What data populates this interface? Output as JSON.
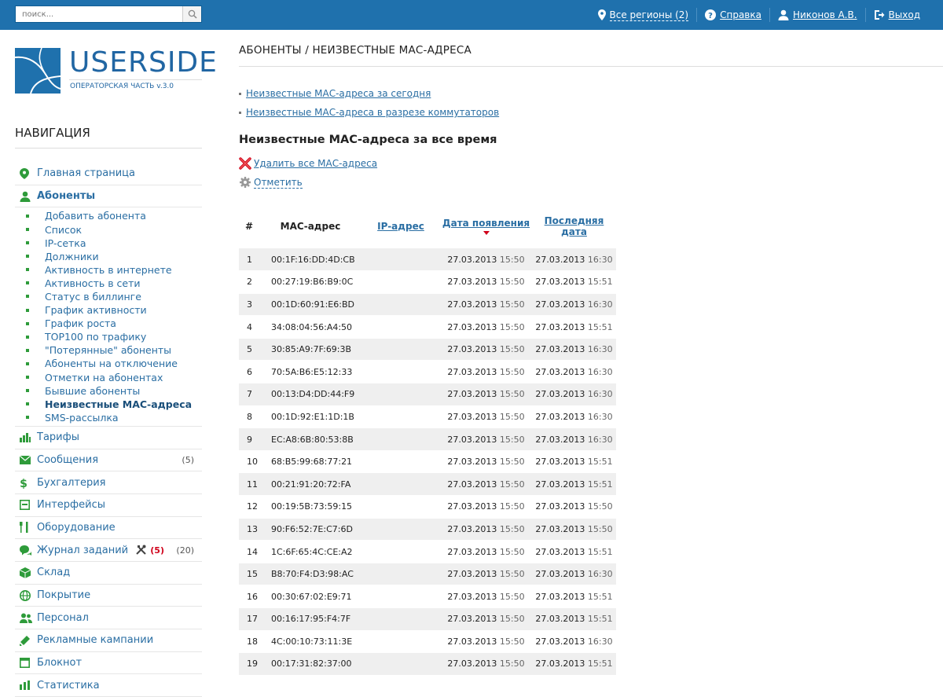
{
  "topbar": {
    "search_placeholder": "поиск...",
    "regions": "Все регионы (2)",
    "help": "Справка",
    "user": "Никонов А.В.",
    "logout": "Выход"
  },
  "logo": {
    "name": "USERSIDE",
    "subtitle": "ОПЕРАТОРСКАЯ ЧАСТЬ v.3.0"
  },
  "nav": {
    "title": "НАВИГАЦИЯ",
    "main_page": "Главная страница",
    "subscribers": "Абоненты",
    "sub_items": [
      "Добавить абонента",
      "Список",
      "IP-сетка",
      "Должники",
      "Активность в интернете",
      "Активность в сети",
      "Статус в биллинге",
      "График активности",
      "График роста",
      "ТОР100 по трафику",
      "\"Потерянные\" абоненты",
      "Абоненты на отключение",
      "Отметки на абонентах",
      "Бывшие абоненты",
      "Неизвестные МАС-адреса",
      "SMS-рассылка"
    ],
    "tariffs": "Тарифы",
    "messages": "Сообщения",
    "messages_count": "(5)",
    "accounting": "Бухгалтерия",
    "interfaces": "Интерфейсы",
    "equipment": "Оборудование",
    "tasks": "Журнал заданий",
    "tasks_red": "(5)",
    "tasks_count": "(20)",
    "warehouse": "Склад",
    "coverage": "Покрытие",
    "staff": "Персонал",
    "ads": "Рекламные кампании",
    "notepad": "Блокнот",
    "stats": "Статистика"
  },
  "main": {
    "page_title": "АБОНЕНТЫ / НЕИЗВЕСТНЫЕ МАС-АДРЕСА",
    "link_today": "Неизвестные МАС-адреса за сегодня",
    "link_switches": "Неизвестные МАС-адреса в разрезе коммутаторов",
    "heading": "Неизвестные МАС-адреса за все время",
    "delete_all": "Удалить все МАС-адреса",
    "mark": "Отметить"
  },
  "table": {
    "headers": {
      "num": "#",
      "mac": "МАС-адрес",
      "ip": "IP-адрес",
      "first": "Дата появления",
      "last": "Последняя дата"
    },
    "rows": [
      {
        "n": "1",
        "mac": "00:1F:16:DD:4D:CB",
        "d1": "27.03.2013",
        "t1": "15:50",
        "d2": "27.03.2013",
        "t2": "16:30"
      },
      {
        "n": "2",
        "mac": "00:27:19:B6:B9:0C",
        "d1": "27.03.2013",
        "t1": "15:50",
        "d2": "27.03.2013",
        "t2": "15:51"
      },
      {
        "n": "3",
        "mac": "00:1D:60:91:E6:BD",
        "d1": "27.03.2013",
        "t1": "15:50",
        "d2": "27.03.2013",
        "t2": "16:30"
      },
      {
        "n": "4",
        "mac": "34:08:04:56:A4:50",
        "d1": "27.03.2013",
        "t1": "15:50",
        "d2": "27.03.2013",
        "t2": "15:51"
      },
      {
        "n": "5",
        "mac": "30:85:A9:7F:69:3B",
        "d1": "27.03.2013",
        "t1": "15:50",
        "d2": "27.03.2013",
        "t2": "16:30"
      },
      {
        "n": "6",
        "mac": "70:5A:B6:E5:12:33",
        "d1": "27.03.2013",
        "t1": "15:50",
        "d2": "27.03.2013",
        "t2": "16:30"
      },
      {
        "n": "7",
        "mac": "00:13:D4:DD:44:F9",
        "d1": "27.03.2013",
        "t1": "15:50",
        "d2": "27.03.2013",
        "t2": "16:30"
      },
      {
        "n": "8",
        "mac": "00:1D:92:E1:1D:1B",
        "d1": "27.03.2013",
        "t1": "15:50",
        "d2": "27.03.2013",
        "t2": "16:30"
      },
      {
        "n": "9",
        "mac": "EC:A8:6B:80:53:8B",
        "d1": "27.03.2013",
        "t1": "15:50",
        "d2": "27.03.2013",
        "t2": "16:30"
      },
      {
        "n": "10",
        "mac": "68:B5:99:68:77:21",
        "d1": "27.03.2013",
        "t1": "15:50",
        "d2": "27.03.2013",
        "t2": "15:51"
      },
      {
        "n": "11",
        "mac": "00:21:91:20:72:FA",
        "d1": "27.03.2013",
        "t1": "15:50",
        "d2": "27.03.2013",
        "t2": "15:51"
      },
      {
        "n": "12",
        "mac": "00:19:5B:73:59:15",
        "d1": "27.03.2013",
        "t1": "15:50",
        "d2": "27.03.2013",
        "t2": "15:50"
      },
      {
        "n": "13",
        "mac": "90:F6:52:7E:C7:6D",
        "d1": "27.03.2013",
        "t1": "15:50",
        "d2": "27.03.2013",
        "t2": "15:50"
      },
      {
        "n": "14",
        "mac": "1C:6F:65:4C:CE:A2",
        "d1": "27.03.2013",
        "t1": "15:50",
        "d2": "27.03.2013",
        "t2": "15:51"
      },
      {
        "n": "15",
        "mac": "B8:70:F4:D3:98:AC",
        "d1": "27.03.2013",
        "t1": "15:50",
        "d2": "27.03.2013",
        "t2": "16:30"
      },
      {
        "n": "16",
        "mac": "00:30:67:02:E9:71",
        "d1": "27.03.2013",
        "t1": "15:50",
        "d2": "27.03.2013",
        "t2": "15:51"
      },
      {
        "n": "17",
        "mac": "00:16:17:95:F4:7F",
        "d1": "27.03.2013",
        "t1": "15:50",
        "d2": "27.03.2013",
        "t2": "15:51"
      },
      {
        "n": "18",
        "mac": "4C:00:10:73:11:3E",
        "d1": "27.03.2013",
        "t1": "15:50",
        "d2": "27.03.2013",
        "t2": "16:30"
      },
      {
        "n": "19",
        "mac": "00:17:31:82:37:00",
        "d1": "27.03.2013",
        "t1": "15:50",
        "d2": "27.03.2013",
        "t2": "15:51"
      }
    ]
  },
  "colors": {
    "topbar": "#1f71ad",
    "link": "#2a6ea3",
    "bullet": "#2e9b3a",
    "sort_arrow": "#d0021b"
  }
}
